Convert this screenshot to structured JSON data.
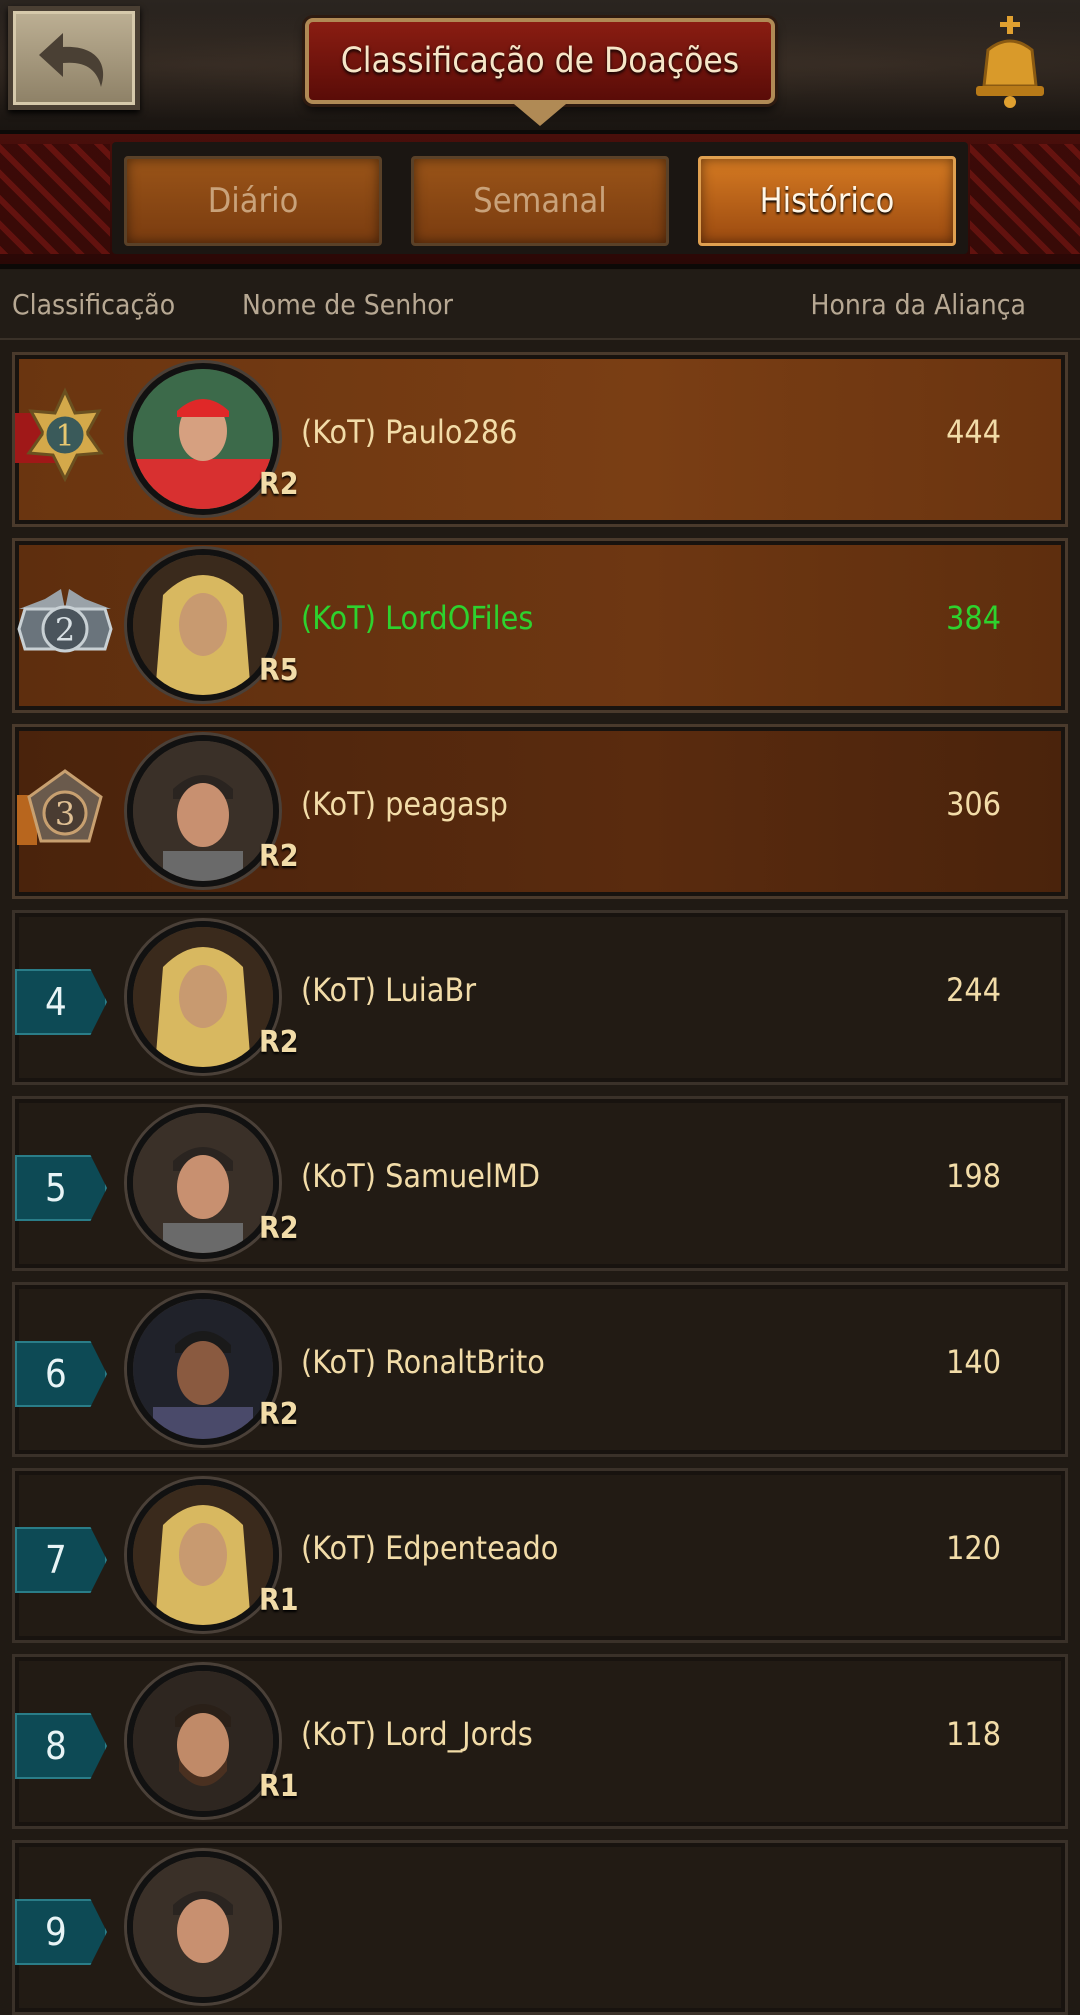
{
  "header": {
    "title": "Classificação de Doações"
  },
  "tabs": [
    {
      "label": "Diário",
      "active": false
    },
    {
      "label": "Semanal",
      "active": false
    },
    {
      "label": "Histórico",
      "active": true
    }
  ],
  "columns": {
    "rank": "Classificação",
    "name": "Nome de Senhor",
    "honor": "Honra da Aliança"
  },
  "rows": [
    {
      "rank": "1",
      "name": "(KoT) Paulo286",
      "role": "R2",
      "honor": "444"
    },
    {
      "rank": "2",
      "name": "(KoT) LordOFiles",
      "role": "R5",
      "honor": "384",
      "highlight": true
    },
    {
      "rank": "3",
      "name": "(KoT) peagasp",
      "role": "R2",
      "honor": "306"
    },
    {
      "rank": "4",
      "name": "(KoT) LuiaBr",
      "role": "R2",
      "honor": "244"
    },
    {
      "rank": "5",
      "name": "(KoT) SamuelMD",
      "role": "R2",
      "honor": "198"
    },
    {
      "rank": "6",
      "name": "(KoT) RonaltBrito",
      "role": "R2",
      "honor": "140"
    },
    {
      "rank": "7",
      "name": "(KoT) Edpenteado",
      "role": "R1",
      "honor": "120"
    },
    {
      "rank": "8",
      "name": "(KoT) Lord_Jords",
      "role": "R1",
      "honor": "118"
    },
    {
      "rank": "9",
      "name": "",
      "role": "",
      "honor": ""
    }
  ],
  "colors": {
    "highlight": "#2ed22e",
    "text": "#f2dca8",
    "rank_tag": "#0d4a55"
  },
  "icons": [
    "back-arrow-icon",
    "bell-icon",
    "gold-medal-icon",
    "silver-medal-icon",
    "bronze-medal-icon"
  ]
}
